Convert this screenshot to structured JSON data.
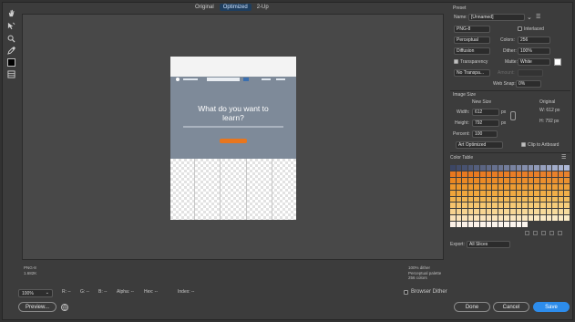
{
  "view_tabs": [
    {
      "label": "Original",
      "active": false
    },
    {
      "label": "Optimized",
      "active": true
    },
    {
      "label": "2-Up",
      "active": false
    }
  ],
  "tools": [
    {
      "icon": "hand-icon"
    },
    {
      "icon": "slice-select-icon"
    },
    {
      "icon": "zoom-icon"
    },
    {
      "icon": "eyedropper-icon"
    },
    {
      "icon": "eyedropper-color-swatch-icon"
    },
    {
      "icon": "toggle-slices-icon"
    }
  ],
  "document_preview": {
    "headline": "What do you want to learn?"
  },
  "status_left": {
    "format": "PNG-8",
    "size": "1.682K"
  },
  "status_right": {
    "line1": "100% dither",
    "line2": "Perceptual palette",
    "line3": "256 colors"
  },
  "bottom_bar": {
    "zoom": "100%",
    "r_label": "R: --",
    "g_label": "G: --",
    "b_label": "B: --",
    "alpha_label": "Alpha: --",
    "hex_label": "Hex: --",
    "index_label": "Index: --",
    "browser_dither": "Browser Dither",
    "preview_button": "Preview...",
    "done_button": "Done",
    "cancel_button": "Cancel",
    "save_button": "Save"
  },
  "preset": {
    "heading": "Preset",
    "name_label": "Name:",
    "name_value": "[Unnamed]",
    "format": "PNG-8",
    "interlaced": "Interlaced",
    "reduction": "Perceptual",
    "colors_label": "Colors:",
    "colors_value": "256",
    "dither_algo": "Diffusion",
    "dither_label": "Dither:",
    "dither_value": "100%",
    "transparency": "Transparency",
    "matte_label": "Matte:",
    "matte_value": "White",
    "transparency_dither": "No Transpa...",
    "amount_label": "Amount:",
    "websnap_label": "Web Snap:",
    "websnap_value": "0%"
  },
  "image_size": {
    "heading": "Image Size",
    "new_size": "New Size",
    "original": "Original",
    "width_label": "Width:",
    "width_value": "612",
    "height_label": "Height:",
    "height_value": "792",
    "unit": "px",
    "orig_w": "W: 612 px",
    "orig_h": "H: 792 px",
    "percent_label": "Percent:",
    "percent_value": "100",
    "quality": "Art Optimized",
    "clip": "Clip to Artboard"
  },
  "color_table": {
    "heading": "Color Table"
  },
  "export": {
    "label": "Export:",
    "value": "All Slices"
  },
  "colors": {
    "accent_blue": "#2d8ceb",
    "cta_orange": "#e8761e"
  }
}
